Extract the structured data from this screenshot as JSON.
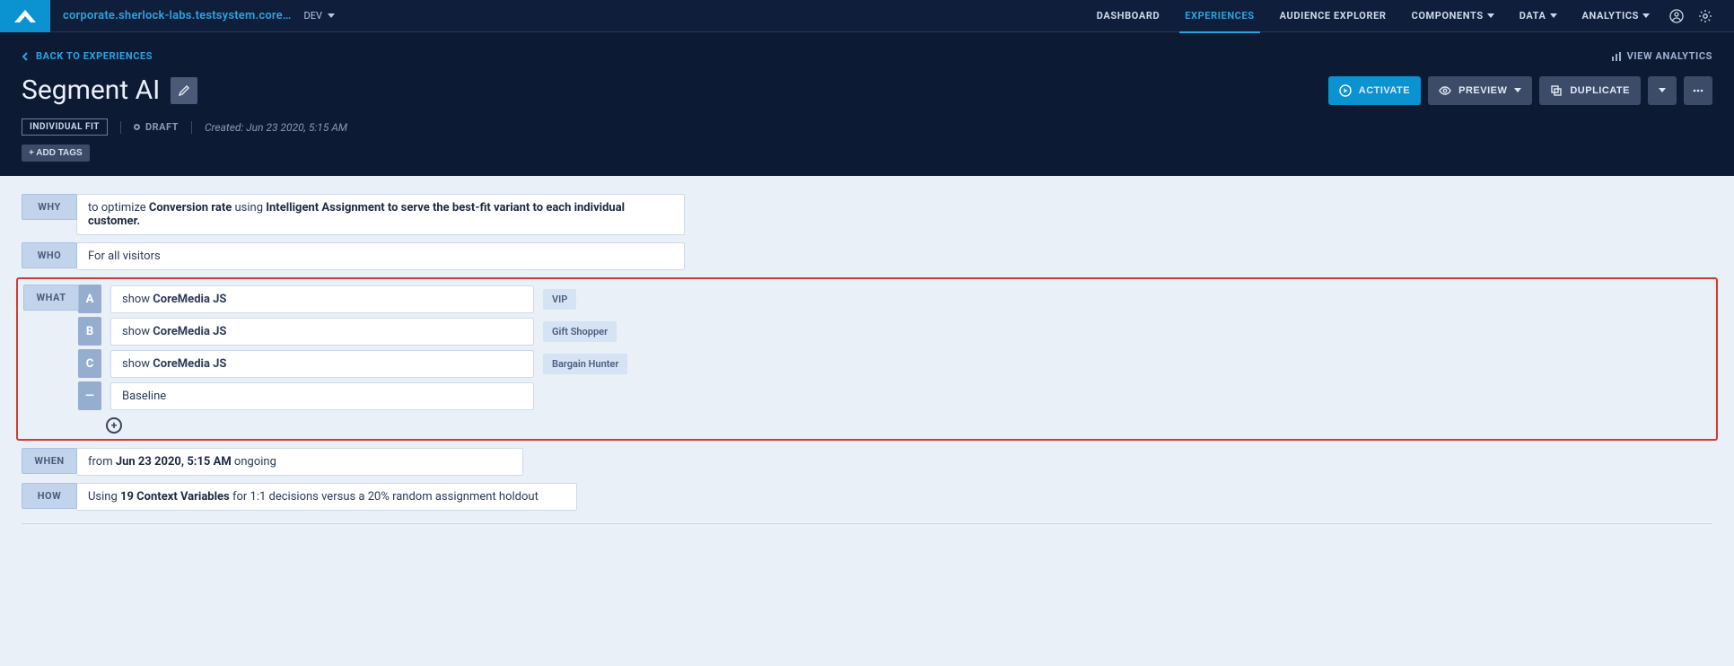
{
  "topnav": {
    "account": "corporate.sherlock-labs.testsystem.core…",
    "env": "DEV",
    "items": [
      "DASHBOARD",
      "EXPERIENCES",
      "AUDIENCE EXPLORER",
      "COMPONENTS",
      "DATA",
      "ANALYTICS"
    ],
    "active_index": 1
  },
  "header": {
    "back": "BACK TO EXPERIENCES",
    "analytics_link": "VIEW ANALYTICS",
    "title": "Segment AI",
    "badge": "INDIVIDUAL FIT",
    "status": "DRAFT",
    "created_label": "Created: Jun 23 2020, 5:15 AM",
    "add_tags": "+ ADD TAGS",
    "buttons": {
      "activate": "ACTIVATE",
      "preview": "PREVIEW",
      "duplicate": "DUPLICATE"
    }
  },
  "why": {
    "label": "WHY",
    "pre": "to optimize ",
    "metric": "Conversion rate",
    "mid": " using ",
    "method": "Intelligent Assignment to serve the best-fit variant to each individual customer."
  },
  "who": {
    "label": "WHO",
    "text": "For all visitors"
  },
  "what": {
    "label": "WHAT",
    "variants": [
      {
        "badge": "A",
        "prefix": "show ",
        "name": "CoreMedia JS",
        "segment": "VIP"
      },
      {
        "badge": "B",
        "prefix": "show ",
        "name": "CoreMedia JS",
        "segment": "Gift Shopper"
      },
      {
        "badge": "C",
        "prefix": "show ",
        "name": "CoreMedia JS",
        "segment": "Bargain Hunter"
      },
      {
        "badge": "—",
        "prefix": "",
        "name": "Baseline",
        "segment": null
      }
    ]
  },
  "when": {
    "label": "WHEN",
    "pre": "from ",
    "date": "Jun 23 2020, 5:15 AM",
    "post": " ongoing"
  },
  "how": {
    "label": "HOW",
    "pre": "Using ",
    "vars": "19 Context Variables",
    "post": " for 1:1 decisions versus a 20% random assignment holdout"
  }
}
